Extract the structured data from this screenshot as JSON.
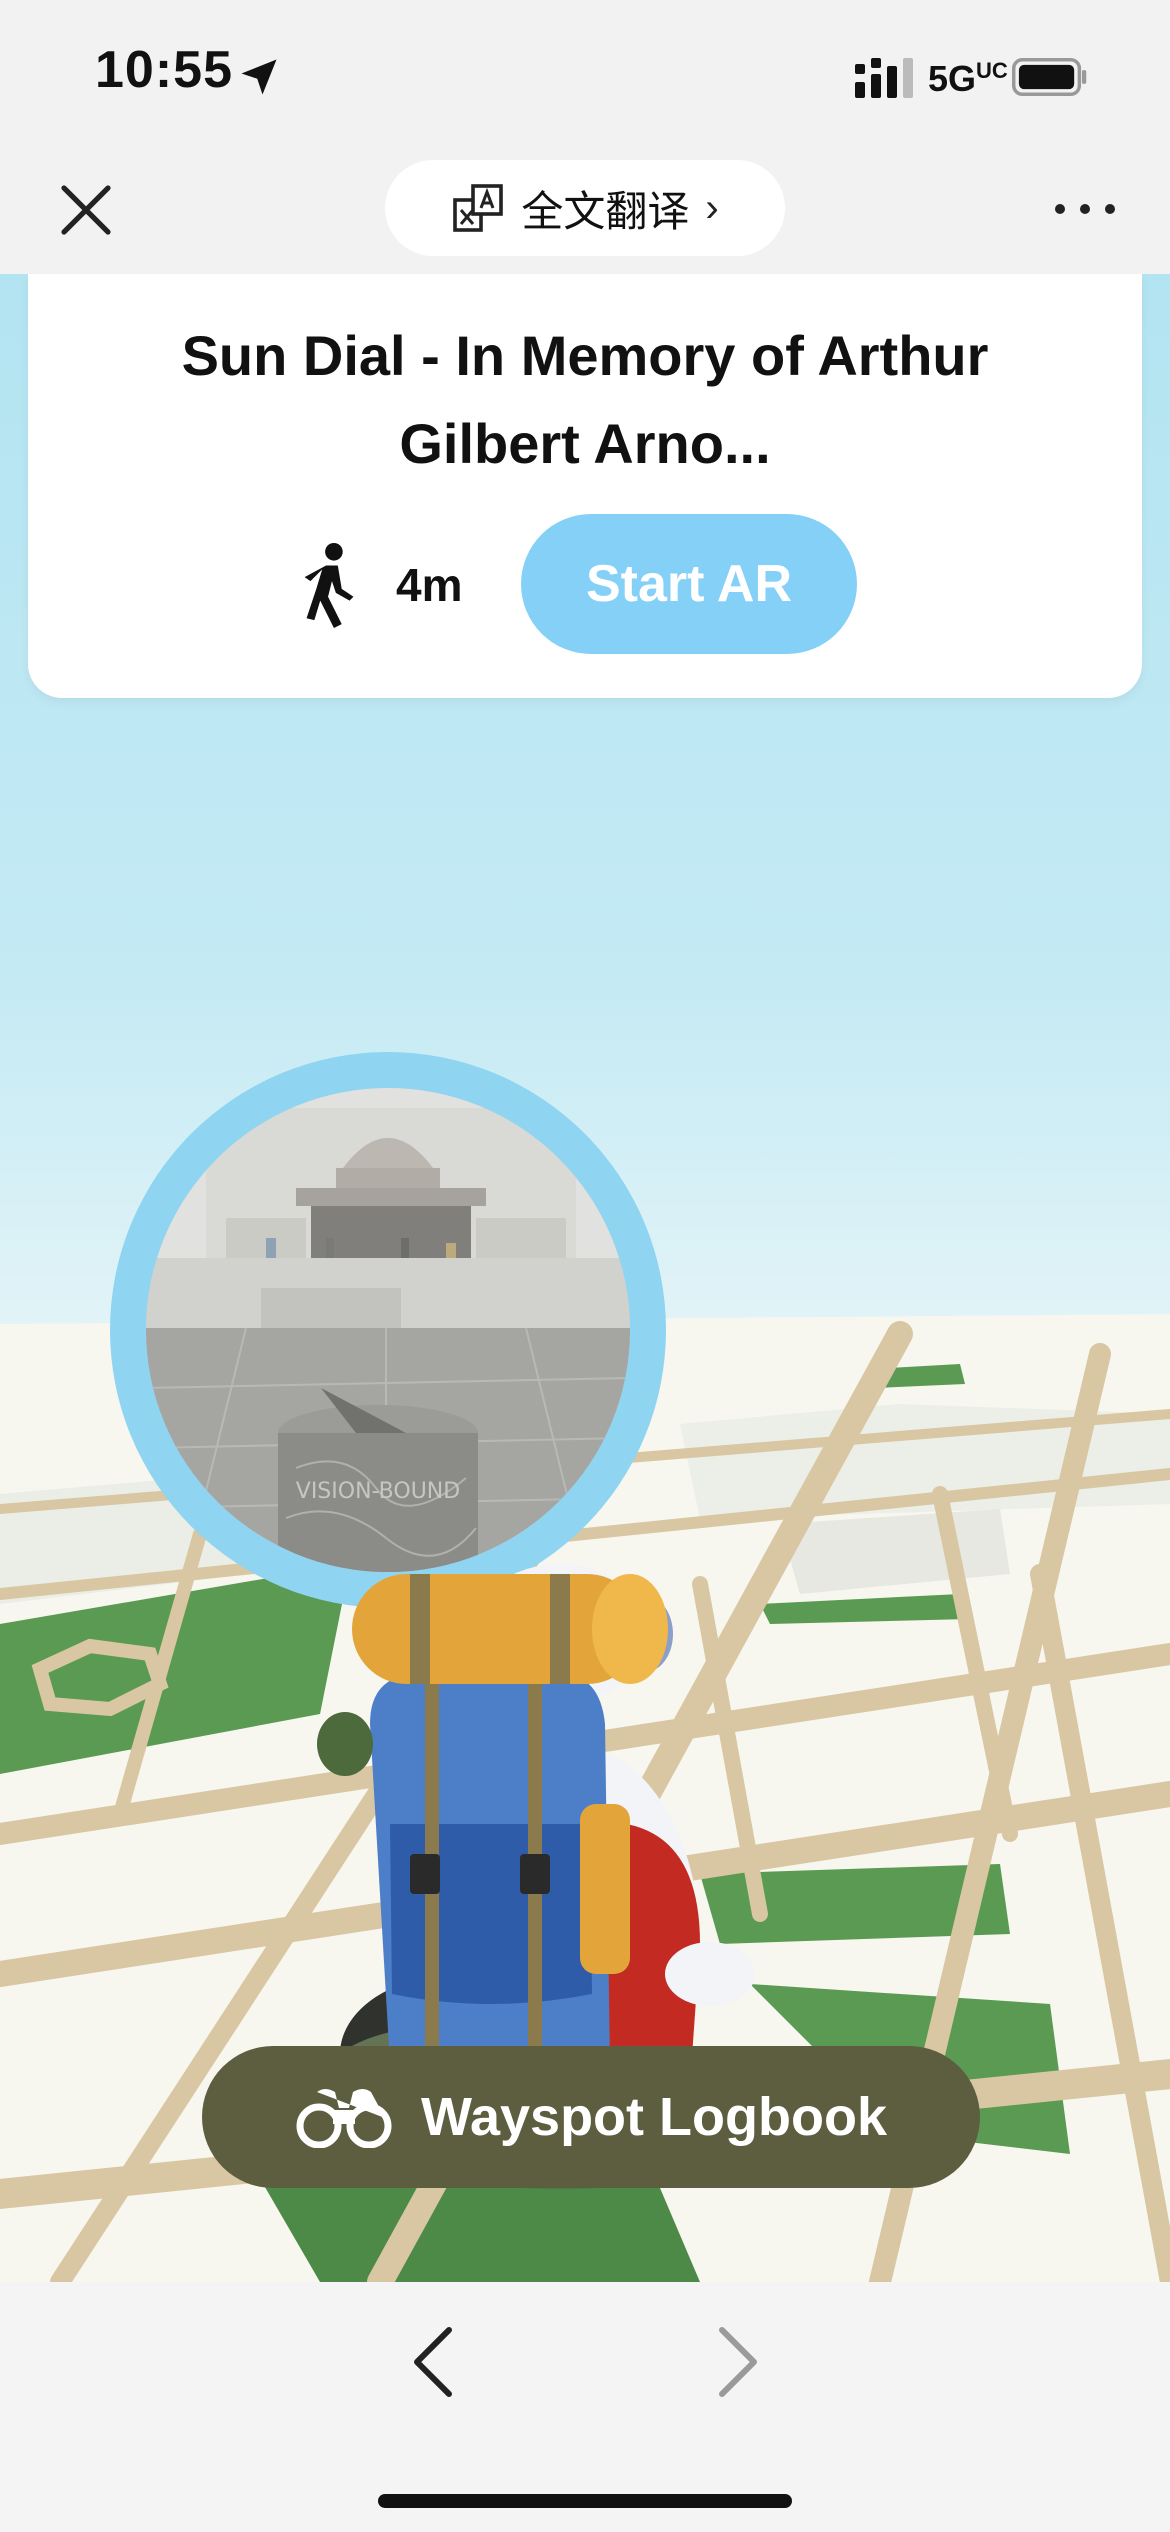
{
  "status_bar": {
    "time": "10:55",
    "network": "5G",
    "network_suffix": "UC"
  },
  "browser": {
    "translate_label": "全文翻译",
    "translate_chevron": "›"
  },
  "poi_card": {
    "title": "Sun Dial - In Memory of Arthur Gilbert Arno...",
    "distance": "4m",
    "start_ar_label": "Start AR"
  },
  "wayspot_photo": {
    "inscription": "VISION-BOUND"
  },
  "logbook": {
    "label": "Wayspot Logbook"
  },
  "colors": {
    "start_ar_bg": "#84d0f6",
    "logbook_bg": "#5d5e40",
    "sky": "#b3e4f2",
    "road": "#d8c7a2",
    "park": "#5a9a52",
    "bubble_ring": "#8fd4f1"
  },
  "icons": {
    "close": "close-icon",
    "translate": "translate-icon",
    "more": "more-icon",
    "walk": "walking-person-icon",
    "logbook": "binoculars-icon",
    "back": "chevron-left-icon",
    "forward": "chevron-right-icon"
  }
}
